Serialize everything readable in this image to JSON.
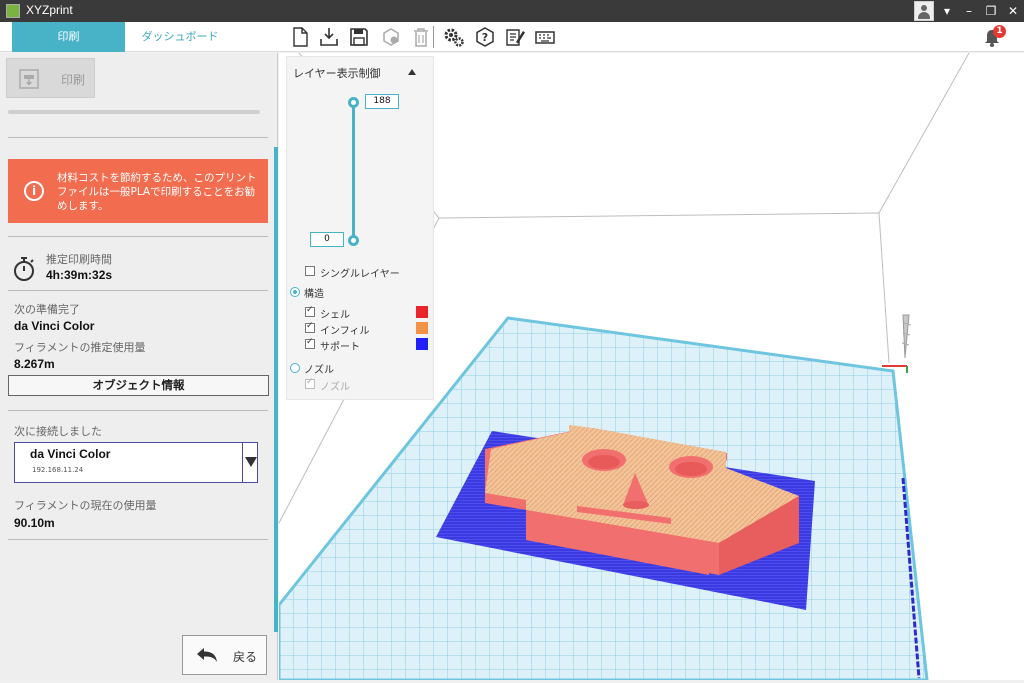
{
  "window": {
    "title": "XYZprint",
    "buttons": {
      "dropdown": "▾",
      "minimize": "–",
      "restore": "❐",
      "close": "✕"
    }
  },
  "tabs": [
    {
      "label": "印刷",
      "active": true
    },
    {
      "label": "ダッシュボード",
      "active": false
    }
  ],
  "toolbar_icons": [
    "new-file-icon",
    "import-icon",
    "save-icon",
    "cube-settings-icon",
    "trash-icon",
    "gear-icon",
    "help-icon",
    "edit-notes-icon",
    "keyboard-icon"
  ],
  "notifications": {
    "count": "1"
  },
  "left_panel": {
    "print_button": "印刷",
    "warning": "材料コストを節約するため、このプリントファイルは一般PLAで印刷することをお勧めします。",
    "estimated_time_label": "推定印刷時間",
    "estimated_time": "4h:39m:32s",
    "next_ready_label": "次の準備完了",
    "next_ready_printer": "da Vinci Color",
    "filament_estimate_label": "フィラメントの推定使用量",
    "filament_estimate": "8.267m",
    "object_info_button": "オブジェクト情報",
    "connected_label": "次に接続しました",
    "printer_name": "da Vinci Color",
    "printer_ip": "192.168.11.24",
    "filament_current_label": "フィラメントの現在の使用量",
    "filament_current": "90.10m",
    "back_button": "戻る"
  },
  "layer_panel": {
    "title": "レイヤー表示制御",
    "layer_max": "188",
    "layer_min": "0",
    "single_layer": "シングルレイヤー",
    "structure": "構造",
    "shell": "シェル",
    "infill": "インフィル",
    "support": "サポート",
    "nozzle": "ノズル",
    "nozzle_sub": "ノズル"
  },
  "colors": {
    "accent": "#48b2c6",
    "shell": "#e8252b",
    "infill": "#f39149",
    "support": "#1f1fff",
    "warning": "#f26d4f"
  }
}
